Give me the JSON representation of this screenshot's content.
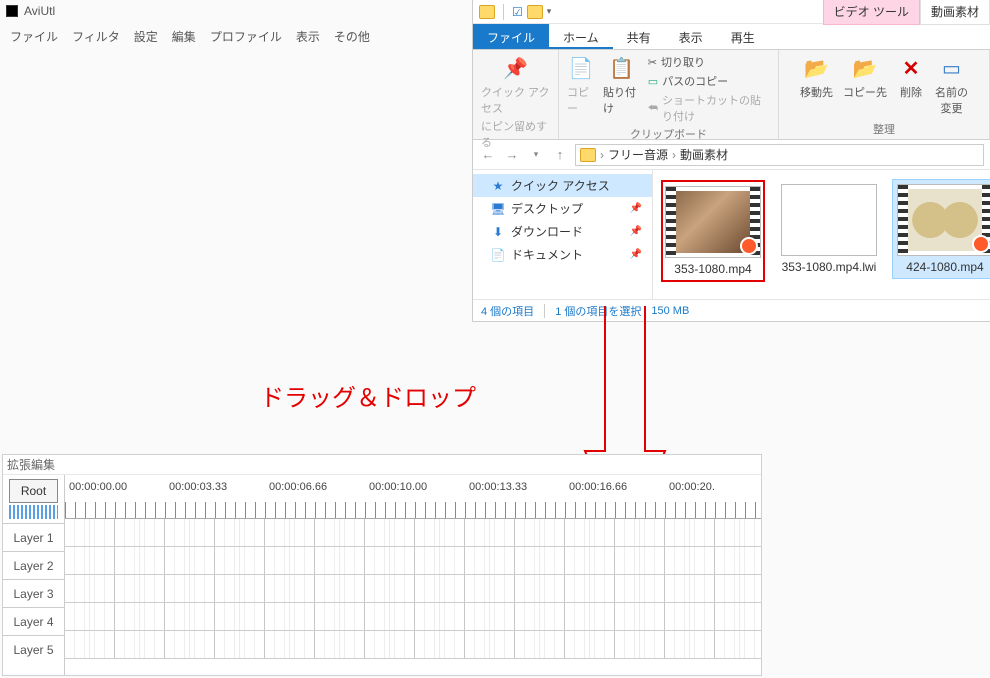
{
  "aviutl": {
    "title": "AviUtl",
    "menu": [
      "ファイル",
      "フィルタ",
      "設定",
      "編集",
      "プロファイル",
      "表示",
      "その他"
    ]
  },
  "explorer": {
    "toolTabs": {
      "video": "ビデオ ツール",
      "folder": "動画素材"
    },
    "tabs": {
      "file": "ファイル",
      "home": "ホーム",
      "share": "共有",
      "view": "表示",
      "play": "再生"
    },
    "ribbon": {
      "pin_group": {
        "quick_access": "クイック アクセス",
        "pin_to": "にピン留めする"
      },
      "clipboard": {
        "copy": "コピー",
        "paste": "貼り付け",
        "cut": "切り取り",
        "copy_path": "パスのコピー",
        "paste_shortcut": "ショートカットの貼り付け",
        "group_label": "クリップボード"
      },
      "organize": {
        "move_to": "移動先",
        "copy_to": "コピー先",
        "delete": "削除",
        "rename": "名前の\n変更",
        "group_label": "整理"
      }
    },
    "breadcrumb": [
      "フリー音源",
      "動画素材"
    ],
    "sidebar": {
      "quick_access": "クイック アクセス",
      "items": [
        {
          "icon": "🖥",
          "label": "デスクトップ"
        },
        {
          "icon": "⬇",
          "label": "ダウンロード"
        },
        {
          "icon": "📄",
          "label": "ドキュメント"
        }
      ]
    },
    "files": [
      {
        "name": "353-1080.mp4",
        "kind": "video",
        "selected": "red"
      },
      {
        "name": "353-1080.mp4.lwi",
        "kind": "blank",
        "selected": "none"
      },
      {
        "name": "424-1080.mp4",
        "kind": "reel",
        "selected": "blue"
      }
    ],
    "status": {
      "count": "4 個の項目",
      "selection": "1 個の項目を選択",
      "size": "150 MB"
    }
  },
  "annotation": {
    "text": "ドラッグ＆ドロップ"
  },
  "timeline": {
    "title": "拡張編集",
    "root": "Root",
    "times": [
      "00:00:00.00",
      "00:00:03.33",
      "00:00:06.66",
      "00:00:10.00",
      "00:00:13.33",
      "00:00:16.66",
      "00:00:20."
    ],
    "layers": [
      "Layer 1",
      "Layer 2",
      "Layer 3",
      "Layer 4",
      "Layer 5"
    ]
  }
}
